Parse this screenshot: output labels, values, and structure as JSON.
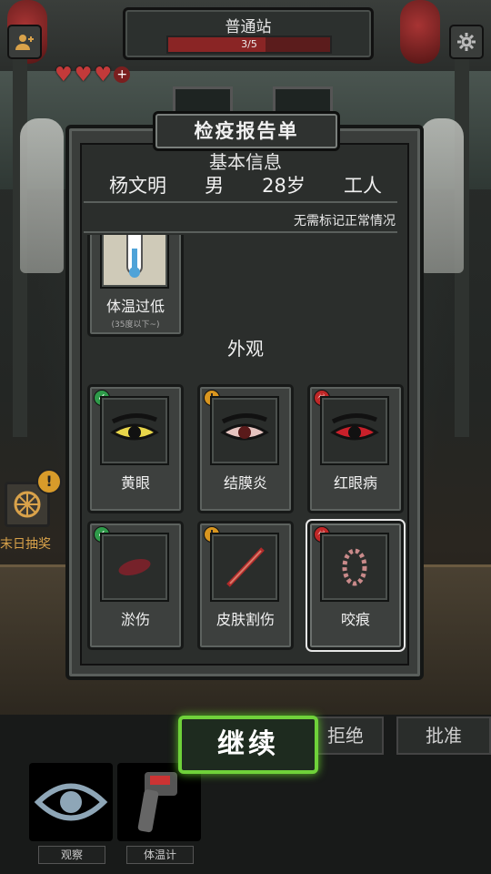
{
  "station": {
    "name": "普通站",
    "progress_text": "3/5",
    "progress_fraction": 0.6
  },
  "lives": {
    "hearts": 3,
    "add_symbol": "+"
  },
  "lottery": {
    "label": "末日抽奖",
    "alert": "!"
  },
  "report": {
    "title": "检疫报告单",
    "info_title": "基本信息",
    "person": {
      "name": "杨文明",
      "gender": "男",
      "age": "28岁",
      "job": "工人"
    },
    "note": "无需标记正常情况",
    "temperature_card": {
      "label": "体温过低",
      "sub": "(35度以下~)"
    },
    "appearance_title": "外观",
    "cards": [
      {
        "label": "黄眼",
        "status": "ok"
      },
      {
        "label": "结膜炎",
        "status": "warn"
      },
      {
        "label": "红眼病",
        "status": "danger"
      },
      {
        "label": "淤伤",
        "status": "ok"
      },
      {
        "label": "皮肤割伤",
        "status": "warn"
      },
      {
        "label": "咬痕",
        "status": "danger"
      }
    ]
  },
  "actions": {
    "continue": "继续",
    "reject": "拒绝",
    "approve": "批准"
  },
  "tools": [
    {
      "label": "观察"
    },
    {
      "label": "体温计"
    }
  ],
  "colors": {
    "ok": "#2f9b4a",
    "warn": "#d9961f",
    "danger": "#c02727",
    "accent_green": "#6fd13a"
  }
}
